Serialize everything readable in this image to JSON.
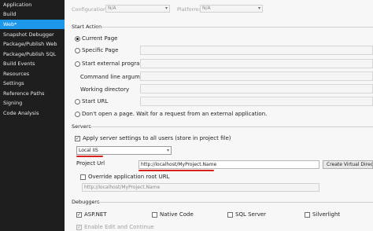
{
  "sidebar": {
    "items": [
      {
        "label": "Application"
      },
      {
        "label": "Build"
      },
      {
        "label": "Web*"
      },
      {
        "label": "Snapshot Debugger"
      },
      {
        "label": "Package/Publish Web"
      },
      {
        "label": "Package/Publish SQL"
      },
      {
        "label": "Build Events"
      },
      {
        "label": "Resources"
      },
      {
        "label": "Settings"
      },
      {
        "label": "Reference Paths"
      },
      {
        "label": "Signing"
      },
      {
        "label": "Code Analysis"
      }
    ],
    "active_index": 2
  },
  "top_bar": {
    "configuration_label": "Configuration:",
    "configuration_value": "N/A",
    "platform_label": "Platform:",
    "platform_value": "N/A"
  },
  "start_action": {
    "title": "Start Action",
    "current_page": "Current Page",
    "specific_page": "Specific Page",
    "start_external_program": "Start external program",
    "command_line_arguments": "Command line arguments",
    "working_directory": "Working directory",
    "start_url": "Start URL",
    "dont_open_page": "Don't open a page.  Wait for a request from an external application.",
    "selected": "current_page"
  },
  "servers": {
    "title": "Servers",
    "apply_settings": "Apply server settings to all users (store in project file)",
    "apply_checked": true,
    "server_value": "Local IIS",
    "project_url_label": "Project Url",
    "project_url_value": "http://localhost/MyProject.Name",
    "create_vdir_button": "Create Virtual Directory",
    "override_label": "Override application root URL",
    "override_checked": false,
    "override_value": "http://localhost/MyProject.Name"
  },
  "debuggers": {
    "title": "Debuggers",
    "aspnet": "ASP.NET",
    "aspnet_checked": true,
    "native_code": "Native Code",
    "native_checked": false,
    "sql_server": "SQL Server",
    "sql_checked": false,
    "silverlight": "Silverlight",
    "silverlight_checked": false,
    "edit_continue": "Enable Edit and Continue",
    "edit_continue_checked": true
  },
  "colors": {
    "accent": "#1c97ea",
    "sidebar_bg": "#1e1e1e",
    "highlight_red": "#d9221c"
  }
}
